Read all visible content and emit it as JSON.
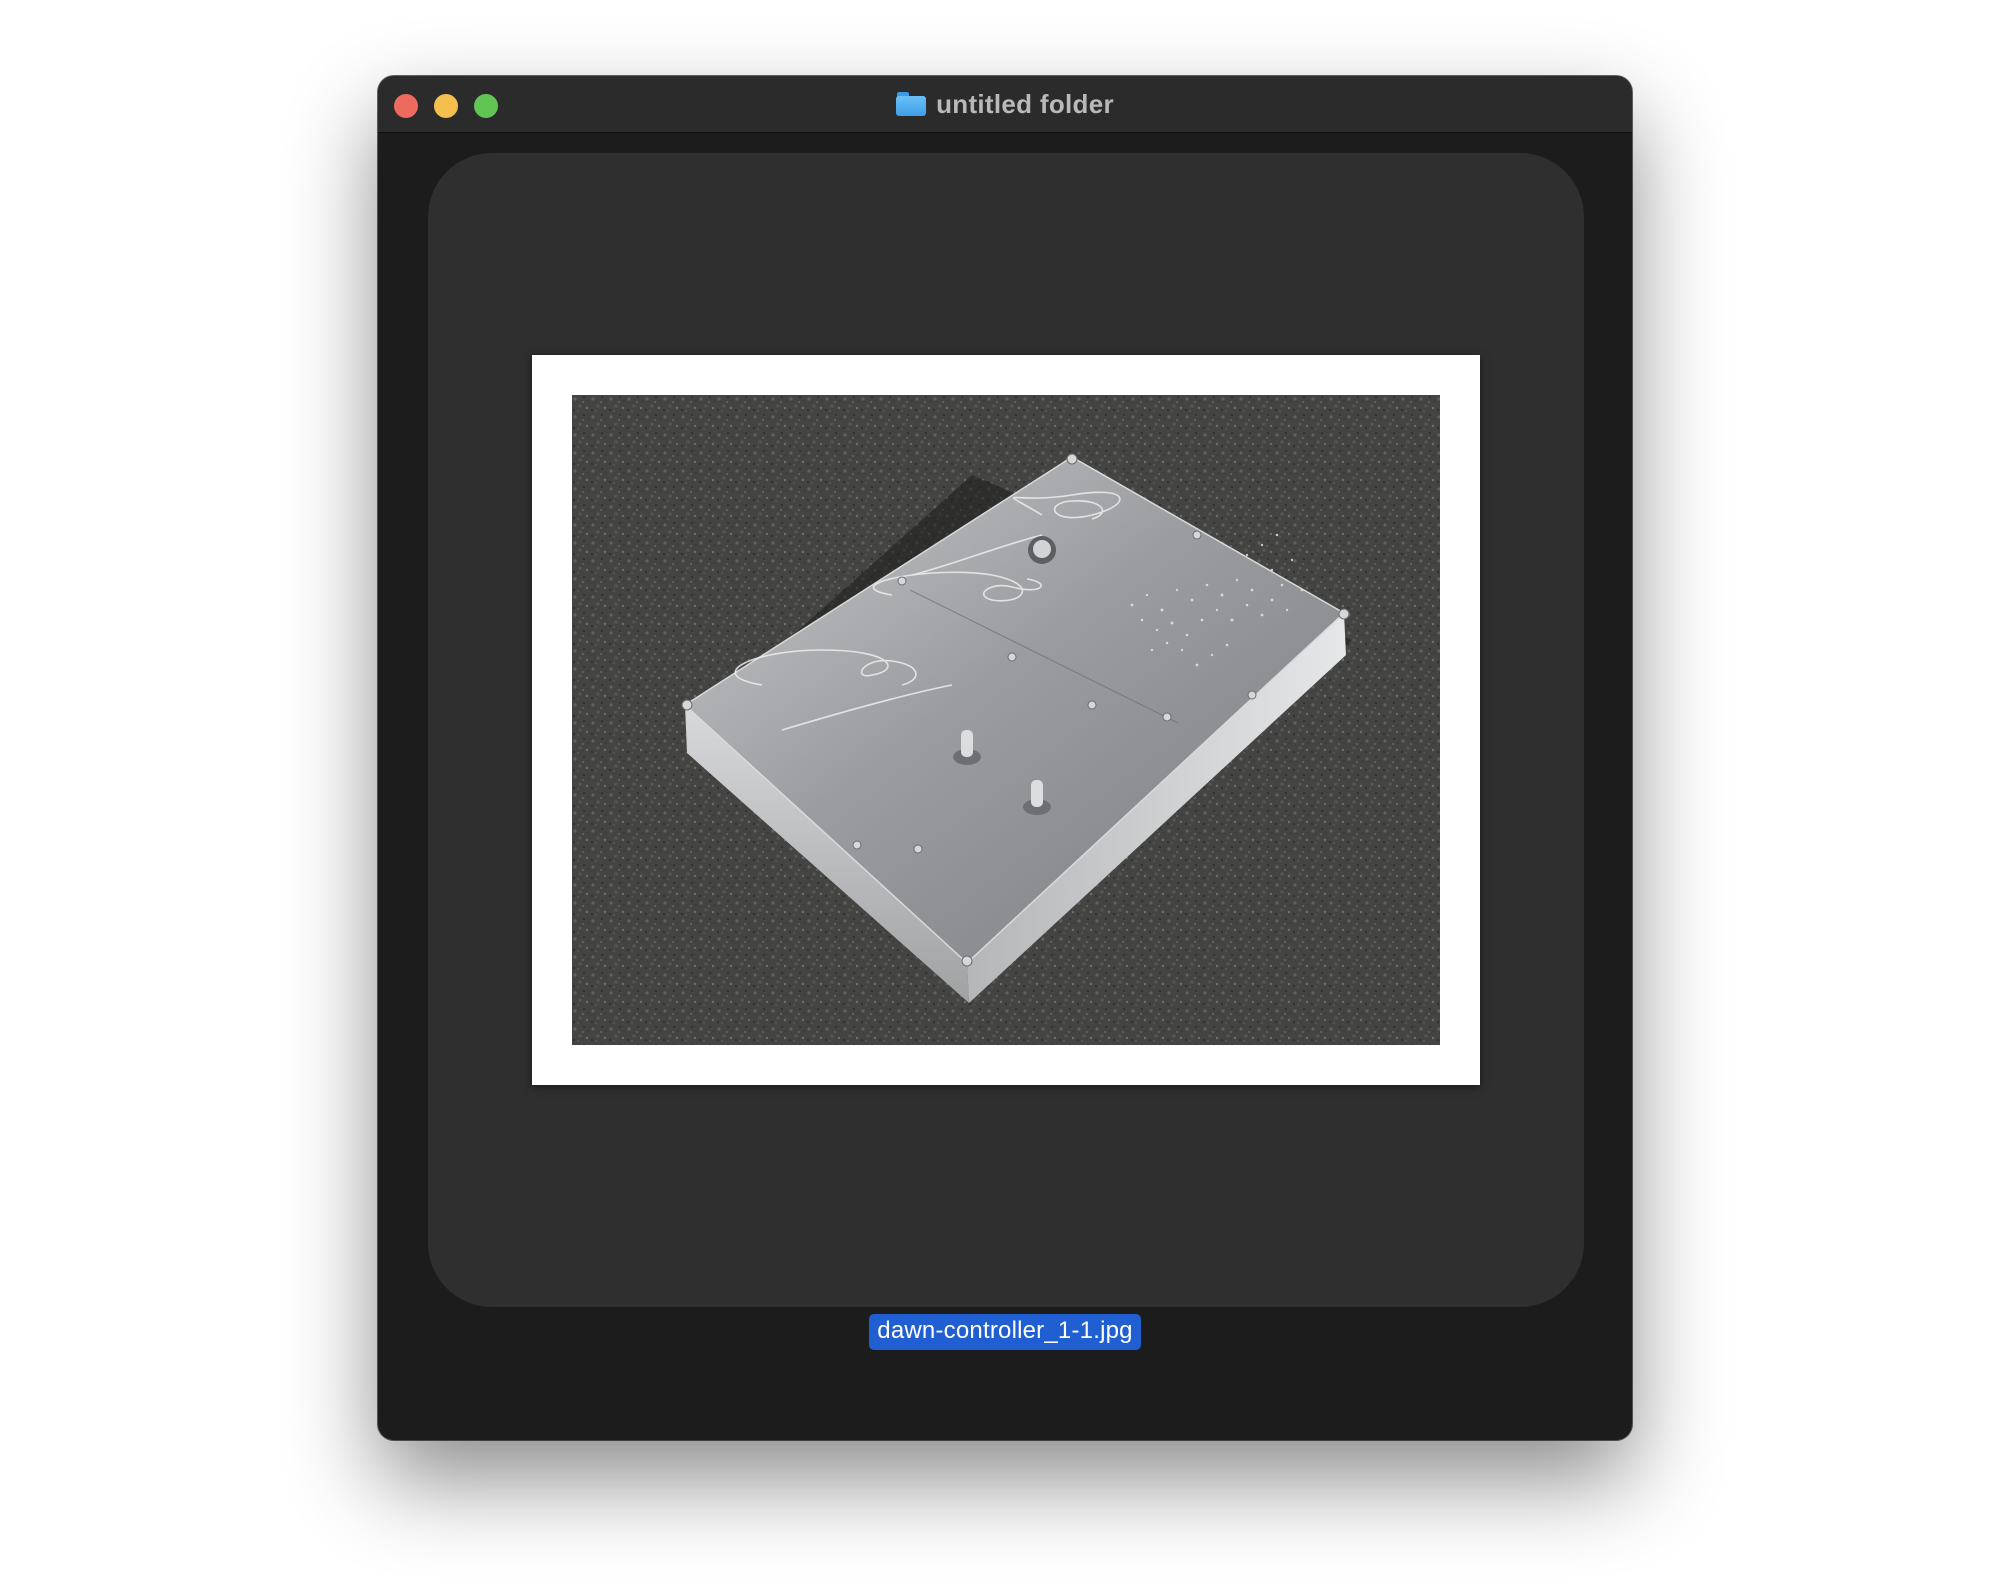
{
  "window": {
    "title": "untitled folder"
  },
  "preview": {
    "filename": "dawn-controller_1-1.jpg"
  },
  "icons": {
    "title": "folder-icon",
    "close": "close-button",
    "minimize": "minimize-button",
    "zoom": "zoom-button"
  },
  "colors": {
    "window_bg": "#1c1c1c",
    "titlebar_bg": "#2b2b2b",
    "panel_bg": "#2f2f2f",
    "selection": "#1f5fd2",
    "close": "#ed6a5e",
    "minimize": "#f5bf4f",
    "zoom": "#61c554"
  }
}
